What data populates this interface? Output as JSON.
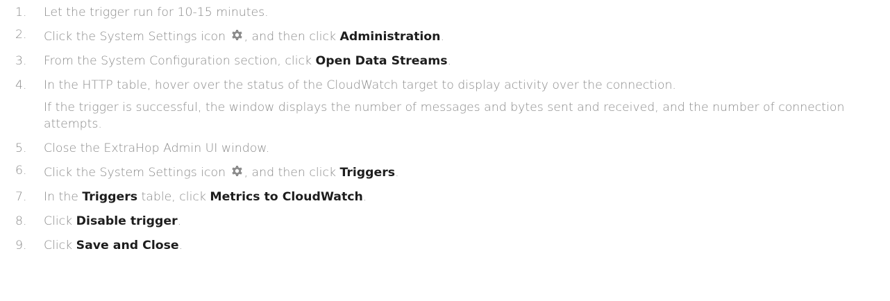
{
  "steps": [
    {
      "num": "1.",
      "parts": [
        "Let the trigger run for 10-15 minutes."
      ]
    },
    {
      "num": "2.",
      "parts": [
        "Click the System Settings icon ",
        ", and then click ",
        "Administration",
        "."
      ]
    },
    {
      "num": "3.",
      "parts": [
        "From the System Configuration section, click ",
        "Open Data Streams",
        "."
      ]
    },
    {
      "num": "4.",
      "parts": [
        "In the HTTP table, hover over the status of the CloudWatch target to display activity over the connection."
      ],
      "note": "If the trigger is successful, the window displays the number of messages and bytes sent and received, and the number of connection attempts."
    },
    {
      "num": "5.",
      "parts": [
        "Close the ExtraHop Admin UI window."
      ]
    },
    {
      "num": "6.",
      "parts": [
        "Click the System Settings icon ",
        ", and then click ",
        "Triggers",
        "."
      ]
    },
    {
      "num": "7.",
      "parts": [
        "In the ",
        "Triggers",
        " table, click ",
        "Metrics to CloudWatch",
        "."
      ]
    },
    {
      "num": "8.",
      "parts": [
        "Click ",
        "Disable trigger",
        "."
      ]
    },
    {
      "num": "9.",
      "parts": [
        "Click ",
        "Save and Close",
        "."
      ]
    }
  ],
  "icons": {
    "gear": "gear-icon",
    "gear_color": "#8c8c8c"
  },
  "colors": {
    "text": "#8a8a8a",
    "emphasis": "#1d1d1d"
  }
}
